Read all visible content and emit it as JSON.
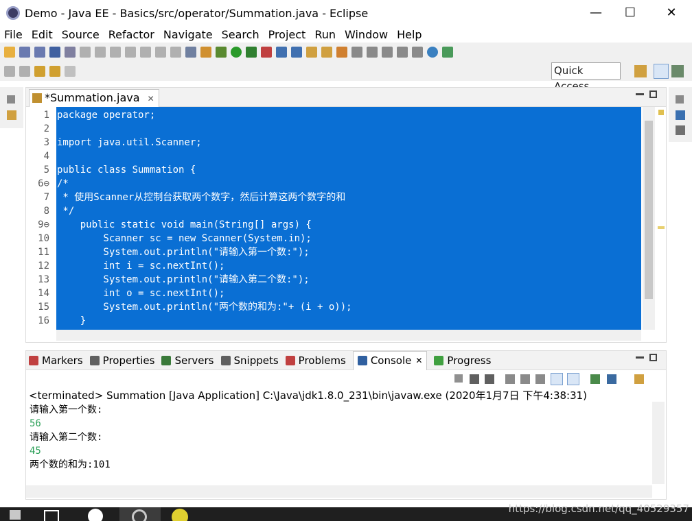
{
  "window": {
    "title": "Demo - Java EE - Basics/src/operator/Summation.java - Eclipse",
    "minimize_glyph": "—",
    "maximize_glyph": "☐",
    "close_glyph": "✕"
  },
  "menu": [
    "File",
    "Edit",
    "Source",
    "Refactor",
    "Navigate",
    "Search",
    "Project",
    "Run",
    "Window",
    "Help"
  ],
  "quick_access": "Quick Access",
  "editor": {
    "tab_label": "*Summation.java",
    "tab_close": "✕",
    "lines": [
      {
        "num": "1",
        "text": "package operator;"
      },
      {
        "num": "2",
        "text": ""
      },
      {
        "num": "3",
        "text": "import java.util.Scanner;"
      },
      {
        "num": "4",
        "text": ""
      },
      {
        "num": "5",
        "text": "public class Summation {"
      },
      {
        "num": "6⊖",
        "text": "/*"
      },
      {
        "num": "7",
        "text": " * 使用Scanner从控制台获取两个数字，然后计算这两个数字的和"
      },
      {
        "num": "8",
        "text": " */"
      },
      {
        "num": "9⊖",
        "text": "    public static void main(String[] args) {"
      },
      {
        "num": "10",
        "text": "        Scanner sc = new Scanner(System.in);"
      },
      {
        "num": "11",
        "text": "        System.out.println(\"请输入第一个数:\");"
      },
      {
        "num": "12",
        "text": "        int i = sc.nextInt();"
      },
      {
        "num": "13",
        "text": "        System.out.println(\"请输入第二个数:\");"
      },
      {
        "num": "14",
        "text": "        int o = sc.nextInt();"
      },
      {
        "num": "15",
        "text": "        System.out.println(\"两个数的和为:\"+ (i + o));"
      },
      {
        "num": "16",
        "text": "    }"
      }
    ]
  },
  "bottom_tabs": [
    {
      "label": "Markers",
      "color": "#c04040"
    },
    {
      "label": "Properties",
      "color": "#606060"
    },
    {
      "label": "Servers",
      "color": "#3a7a3a"
    },
    {
      "label": "Snippets",
      "color": "#606060"
    },
    {
      "label": "Problems",
      "color": "#c04040"
    },
    {
      "label": "Console",
      "color": "#3060a0",
      "active": true
    },
    {
      "label": "Progress",
      "color": "#40a040"
    }
  ],
  "console": {
    "tab_close": "✕",
    "terminated": "<terminated> Summation [Java Application] C:\\Java\\jdk1.8.0_231\\bin\\javaw.exe (2020年1月7日 下午4:38:31)",
    "output": [
      {
        "text": "请输入第一个数:",
        "kind": "stdout"
      },
      {
        "text": "56",
        "kind": "stdin"
      },
      {
        "text": "请输入第二个数:",
        "kind": "stdout"
      },
      {
        "text": "45",
        "kind": "stdin"
      },
      {
        "text": "两个数的和为:101",
        "kind": "stdout"
      }
    ]
  },
  "watermark": "https://blog.csdn.net/qq_40529357",
  "colors": {
    "selection": "#0a6fd4",
    "input_green": "#2ca058"
  }
}
